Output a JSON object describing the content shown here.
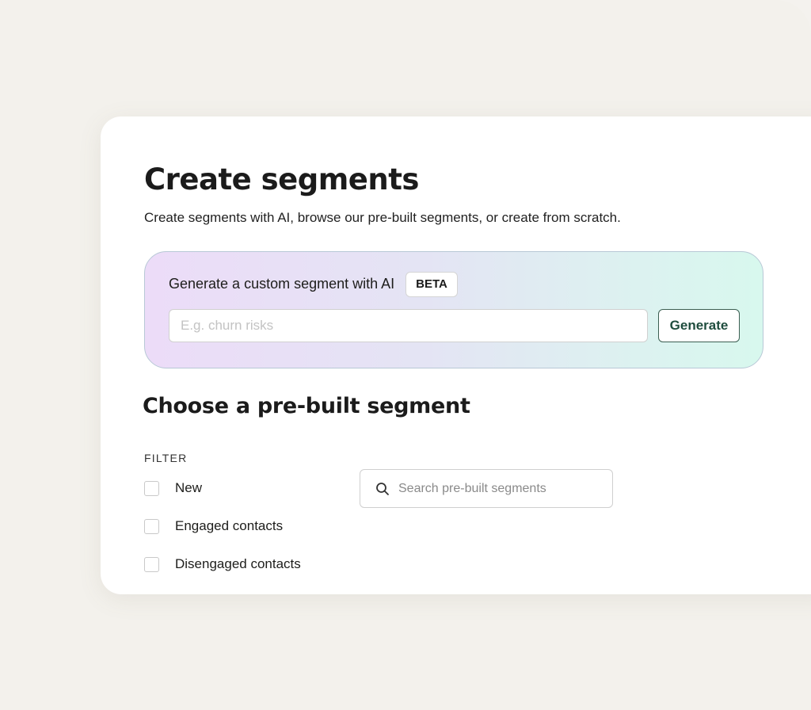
{
  "page": {
    "title": "Create segments",
    "subtitle": "Create segments with AI, browse our pre-built segments, or create from scratch."
  },
  "ai_generator": {
    "label": "Generate a custom segment with AI",
    "badge": "BETA",
    "input_value": "",
    "input_placeholder": "E.g. churn risks",
    "button_label": "Generate"
  },
  "prebuilt": {
    "title": "Choose a pre-built segment",
    "filter_heading": "FILTER",
    "filters": [
      {
        "label": "New",
        "checked": false
      },
      {
        "label": "Engaged contacts",
        "checked": false
      },
      {
        "label": "Disengaged contacts",
        "checked": false
      }
    ],
    "search": {
      "value": "",
      "placeholder": "Search pre-built segments",
      "icon": "search-icon"
    }
  },
  "colors": {
    "page_background": "#f4f2ee",
    "card_background": "#ffffff",
    "generate_button_text": "#1f4d3e",
    "ai_gradient_start": "#ecdcf8",
    "ai_gradient_end": "#d8f8ee"
  }
}
